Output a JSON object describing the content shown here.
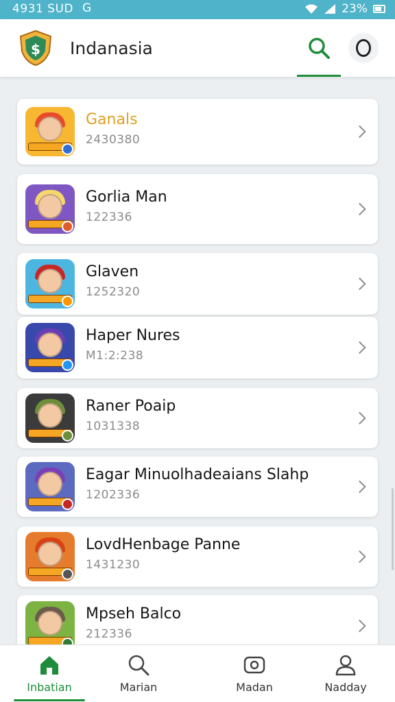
{
  "status_bar": {
    "time": "4931 SUD",
    "notification": "G",
    "battery": "23%"
  },
  "app_bar": {
    "title": "Indanasia"
  },
  "items": [
    {
      "title": "Ganals",
      "subtitle": "2430380",
      "title_color": "#e0a020",
      "thumb_bg": "#f7b731",
      "hair": "#e84a2c",
      "badge": "#2f6fd1"
    },
    {
      "title": "Gorlia Man",
      "subtitle": "122336",
      "title_color": "#151515",
      "thumb_bg": "#7e57c2",
      "hair": "#f5d76e",
      "badge": "#e05a2a"
    },
    {
      "title": "Glaven",
      "subtitle": "1252320",
      "title_color": "#151515",
      "thumb_bg": "#4db6e0",
      "hair": "#c62828",
      "badge": "#ff9800"
    },
    {
      "title": "Haper Nures",
      "subtitle": "M1:2:238",
      "title_color": "#151515",
      "thumb_bg": "#3949ab",
      "hair": "#6a3fb3",
      "badge": "#2196f3"
    },
    {
      "title": "Raner Poaip",
      "subtitle": "1031338",
      "title_color": "#151515",
      "thumb_bg": "#3b3b3b",
      "hair": "#6d8f3a",
      "badge": "#6d8f3a"
    },
    {
      "title": "Eagar Minuolhadeaians Slahp",
      "subtitle": "1202336",
      "title_color": "#151515",
      "thumb_bg": "#5c6bc0",
      "hair": "#7b3fb5",
      "badge": "#c62828"
    },
    {
      "title": "LovdHenbage Panne",
      "subtitle": "1431230",
      "title_color": "#151515",
      "thumb_bg": "#e57b2d",
      "hair": "#d84315",
      "badge": "#555555"
    },
    {
      "title": "Mpseh Balco",
      "subtitle": "212336",
      "title_color": "#151515",
      "thumb_bg": "#7cb342",
      "hair": "#6b5b4b",
      "badge": "#2e7d32"
    }
  ],
  "bottom_nav": [
    {
      "label": "Inbatian",
      "icon": "home-icon"
    },
    {
      "label": "Marian",
      "icon": "search-icon"
    },
    {
      "label": "Madan",
      "icon": "gamepad-icon"
    },
    {
      "label": "Nadday",
      "icon": "profile-icon"
    }
  ],
  "colors": {
    "accent": "#1e8c3a",
    "status_bar": "#4fb3c9",
    "highlight_title": "#e0a020"
  }
}
